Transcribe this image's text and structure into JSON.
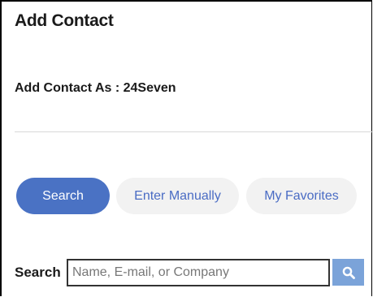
{
  "panel": {
    "title": "Add Contact",
    "add_as_label": "Add Contact As",
    "add_as_separator": " : ",
    "add_as_value": "24Seven"
  },
  "tabs": [
    {
      "label": "Search",
      "active": true
    },
    {
      "label": "Enter Manually",
      "active": false
    },
    {
      "label": "My Favorites",
      "active": false
    }
  ],
  "search": {
    "label": "Search",
    "value": "",
    "placeholder": "Name, E-mail, or Company",
    "button_icon": "search-icon"
  },
  "colors": {
    "active_tab_bg": "#4a72c4",
    "inactive_tab_bg": "#f2f2f2",
    "inactive_tab_text": "#4a6cc4",
    "search_button_bg": "#7ba3d9"
  }
}
